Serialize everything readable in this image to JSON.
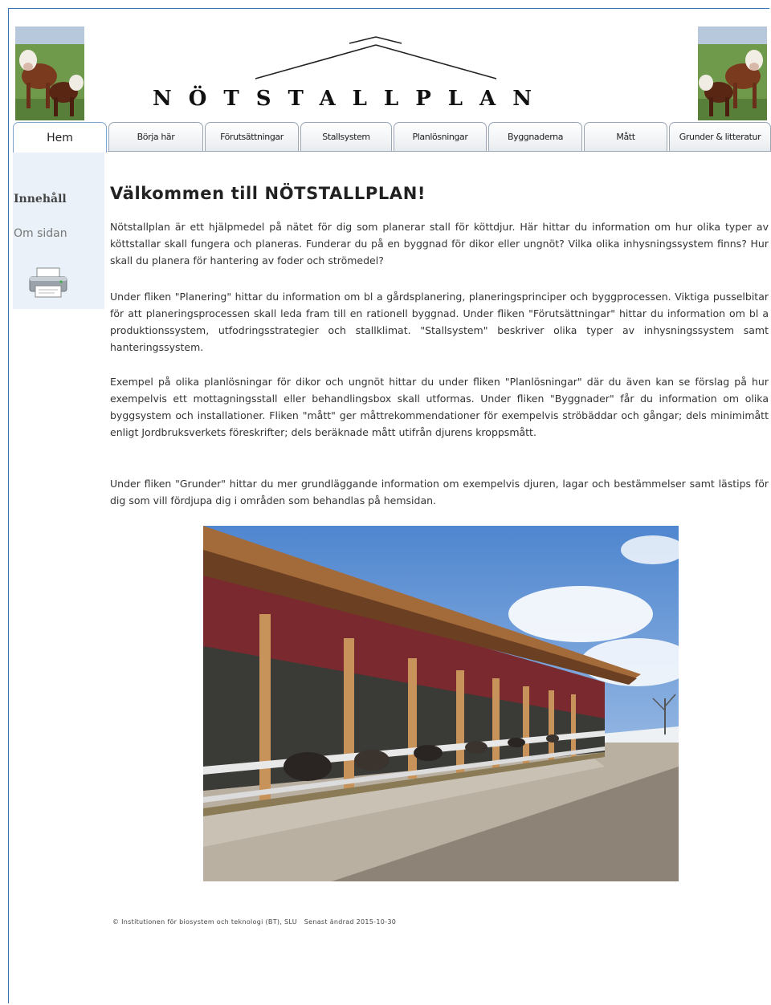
{
  "header": {
    "logo_text": "NÖTSTALLPLAN"
  },
  "tabs": [
    {
      "label": "Hem",
      "active": true
    },
    {
      "label": "Börja här"
    },
    {
      "label": "Förutsättningar"
    },
    {
      "label": "Stallsystem"
    },
    {
      "label": "Planlösningar"
    },
    {
      "label": "Byggnaderna"
    },
    {
      "label": "Mått"
    },
    {
      "label": "Grunder & litteratur"
    }
  ],
  "sidebar": {
    "title": "Innehåll",
    "link": "Om sidan",
    "print_icon": "printer-icon"
  },
  "main": {
    "heading": "Välkommen till NÖTSTALLPLAN!",
    "paragraphs": [
      "Nötstallplan är ett hjälpmedel på nätet för dig som planerar stall för köttdjur. Här hittar du information om hur olika typer av köttstallar skall fungera och planeras. Funderar du på en byggnad för dikor eller ungnöt? Vilka olika inhysningssystem finns? Hur skall du planera för hantering av foder och strömedel?",
      "Under fliken \"Planering\" hittar du information om bl a gårdsplanering, planeringsprinciper och byggprocessen. Viktiga pusselbitar för att planeringsprocessen skall leda fram till en rationell byggnad. Under fliken \"Förutsättningar\" hittar du information om bl a produktionssystem, utfodringsstrategier och stallklimat. \"Stallsystem\" beskriver olika typer av inhysningssystem samt hanteringssystem.",
      "Exempel på olika planlösningar för dikor och ungnöt hittar du under fliken \"Planlösningar\" där du även kan se förslag på hur exempelvis ett mottagningsstall eller behandlingsbox skall utformas. Under fliken \"Byggnader\" får du information om olika byggsystem och installationer. Fliken \"mått\" ger måttrekommendationer för exempelvis ströbäddar och gångar; dels minimimått enligt Jordbruksverkets föreskrifter; dels beräknade mått utifrån djurens kroppsmått.",
      "Under fliken \"Grunder\" hittar du mer grundläggande information om exempelvis djuren, lagar och bestämmelser samt lästips för dig som vill fördjupa dig i områden som behandlas på hemsidan."
    ]
  },
  "footer": {
    "copyright": "© Institutionen för biosystem och teknologi (BT), SLU",
    "updated": "Senast ändrad 2015-10-30"
  },
  "colors": {
    "frame_border": "#3a6fb0",
    "sidebar_bg": "#eaf1f8",
    "active_tab_border": "#7fa6cf"
  }
}
